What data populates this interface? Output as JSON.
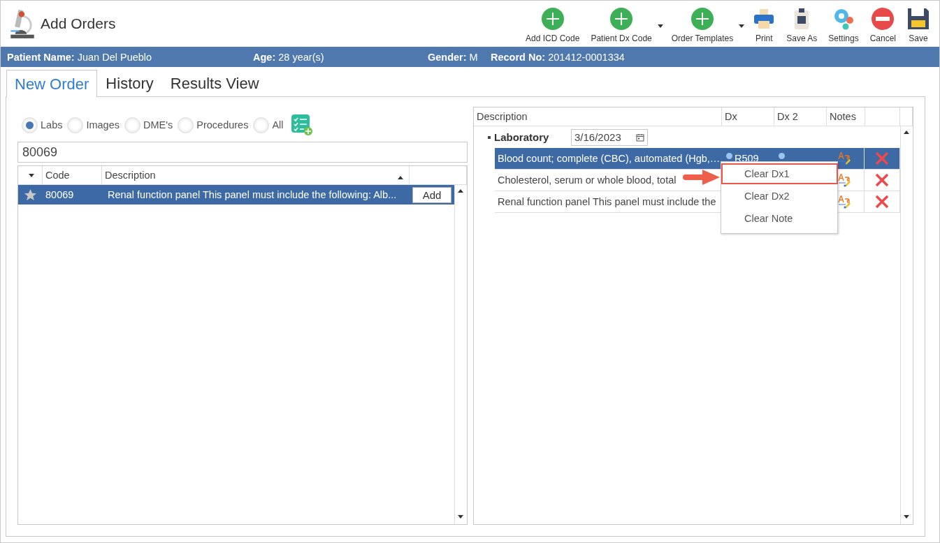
{
  "window": {
    "title": "Add Orders"
  },
  "toolbar": [
    {
      "label": "Add ICD Code",
      "kind": "add",
      "dropdown": false
    },
    {
      "label": "Patient Dx Code",
      "kind": "add",
      "dropdown": true
    },
    {
      "label": "Order Templates",
      "kind": "add",
      "dropdown": true
    },
    {
      "label": "Print",
      "kind": "print",
      "dropdown": false
    },
    {
      "label": "Save As",
      "kind": "saveas",
      "dropdown": false
    },
    {
      "label": "Settings",
      "kind": "settings",
      "dropdown": false
    },
    {
      "label": "Cancel",
      "kind": "cancel",
      "dropdown": false
    },
    {
      "label": "Save",
      "kind": "save",
      "dropdown": false
    }
  ],
  "patient": [
    {
      "label": "Patient Name:",
      "value": "Juan Del Pueblo"
    },
    {
      "label": "Age:",
      "value": "28 year(s)"
    },
    {
      "label": "Gender:",
      "value": "M"
    },
    {
      "label": "Record No:",
      "value": "201412-0001334"
    }
  ],
  "tabs": [
    {
      "label": "New Order",
      "selected": true
    },
    {
      "label": "History",
      "selected": false
    },
    {
      "label": "Results View",
      "selected": false
    }
  ],
  "filters": [
    {
      "label": "Labs",
      "selected": true
    },
    {
      "label": "Images",
      "selected": false
    },
    {
      "label": "DME's",
      "selected": false
    },
    {
      "label": "Procedures",
      "selected": false
    },
    {
      "label": "All",
      "selected": false
    }
  ],
  "search": {
    "value": "80069"
  },
  "codes": {
    "columns": [
      "Code",
      "Description"
    ],
    "rows": [
      {
        "code": "80069",
        "description": "Renal function panel This panel must include the following: Alb...",
        "button": "Add",
        "selected": true
      }
    ]
  },
  "orders": {
    "columns": [
      "Description",
      "Dx",
      "Dx 2",
      "Notes"
    ],
    "group": {
      "label": "Laboratory",
      "date": "3/16/2023",
      "expanded": true
    },
    "rows": [
      {
        "description": "Blood count; complete (CBC), automated (Hgb,…",
        "dx": "R509",
        "selected": true
      },
      {
        "description": "Cholesterol, serum or whole blood, total",
        "dx": "",
        "selected": false
      },
      {
        "description": "Renal function panel This panel must include the",
        "dx": "",
        "selected": false
      }
    ]
  },
  "context_menu": [
    {
      "label": "Clear Dx1",
      "selected": true
    },
    {
      "label": "Clear Dx2",
      "selected": false
    },
    {
      "label": "Clear Note",
      "selected": false
    }
  ]
}
